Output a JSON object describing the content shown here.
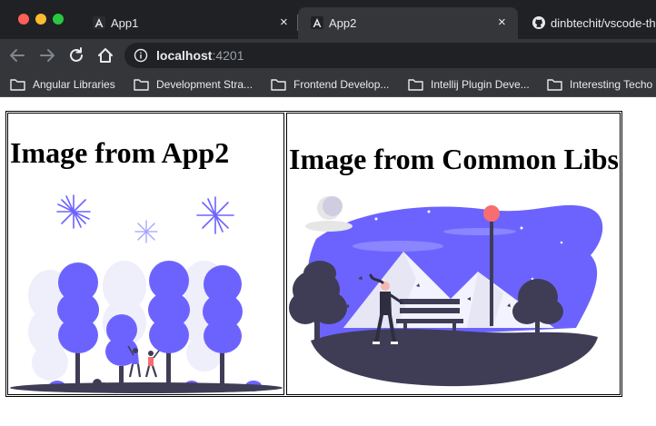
{
  "browser": {
    "tabs": [
      {
        "title": "App1",
        "close": "×"
      },
      {
        "title": "App2",
        "close": "×"
      },
      {
        "title": "dinbtechit/vscode-th"
      }
    ],
    "address": {
      "host": "localhost",
      "port": ":4201"
    },
    "bookmarks": [
      "Angular Libraries",
      "Development Stra...",
      "Frontend Develop...",
      "Intellij Plugin Deve...",
      "Interesting Techo"
    ]
  },
  "page": {
    "cells": [
      {
        "title": "Image from App2"
      },
      {
        "title": "Image from Common Libs"
      }
    ]
  },
  "colors": {
    "tab_bar": "#202124",
    "toolbar": "#35363a",
    "illustration_purple": "#6c63ff",
    "illustration_dark": "#3f3d56"
  }
}
